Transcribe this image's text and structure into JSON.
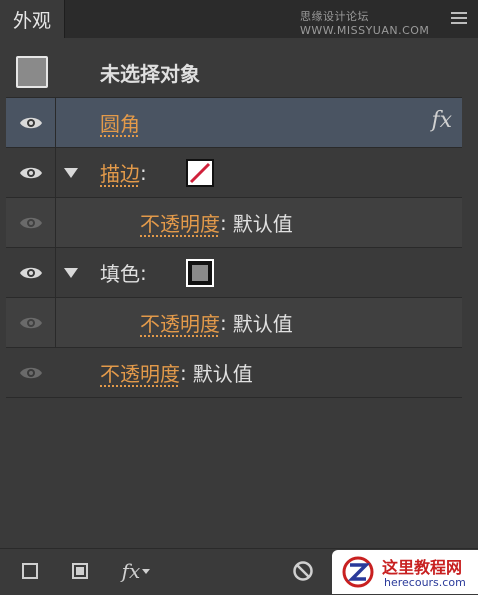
{
  "panel": {
    "tab_label": "外观",
    "watermark_top": "思缘设计论坛 WWW.MISSYUAN.COM"
  },
  "rows": {
    "object": {
      "label": "未选择对象"
    },
    "effect": {
      "label": "圆角",
      "fx": "fx"
    },
    "stroke": {
      "label": "描边",
      "colon": ":"
    },
    "stroke_opacity": {
      "label": "不透明度",
      "colon": ":",
      "value": "默认值"
    },
    "fill": {
      "label": "填色",
      "colon": ":"
    },
    "fill_opacity": {
      "label": "不透明度",
      "colon": ":",
      "value": "默认值"
    },
    "opacity": {
      "label": "不透明度",
      "colon": ":",
      "value": "默认值"
    }
  },
  "toolbar": {
    "fx_label": "fx"
  },
  "badge": {
    "title": "这里教程网",
    "url": "herecours.com"
  },
  "colors": {
    "link": "#e39a4a",
    "selected_row": "#4a5462",
    "panel_bg": "#3a3a3a"
  }
}
